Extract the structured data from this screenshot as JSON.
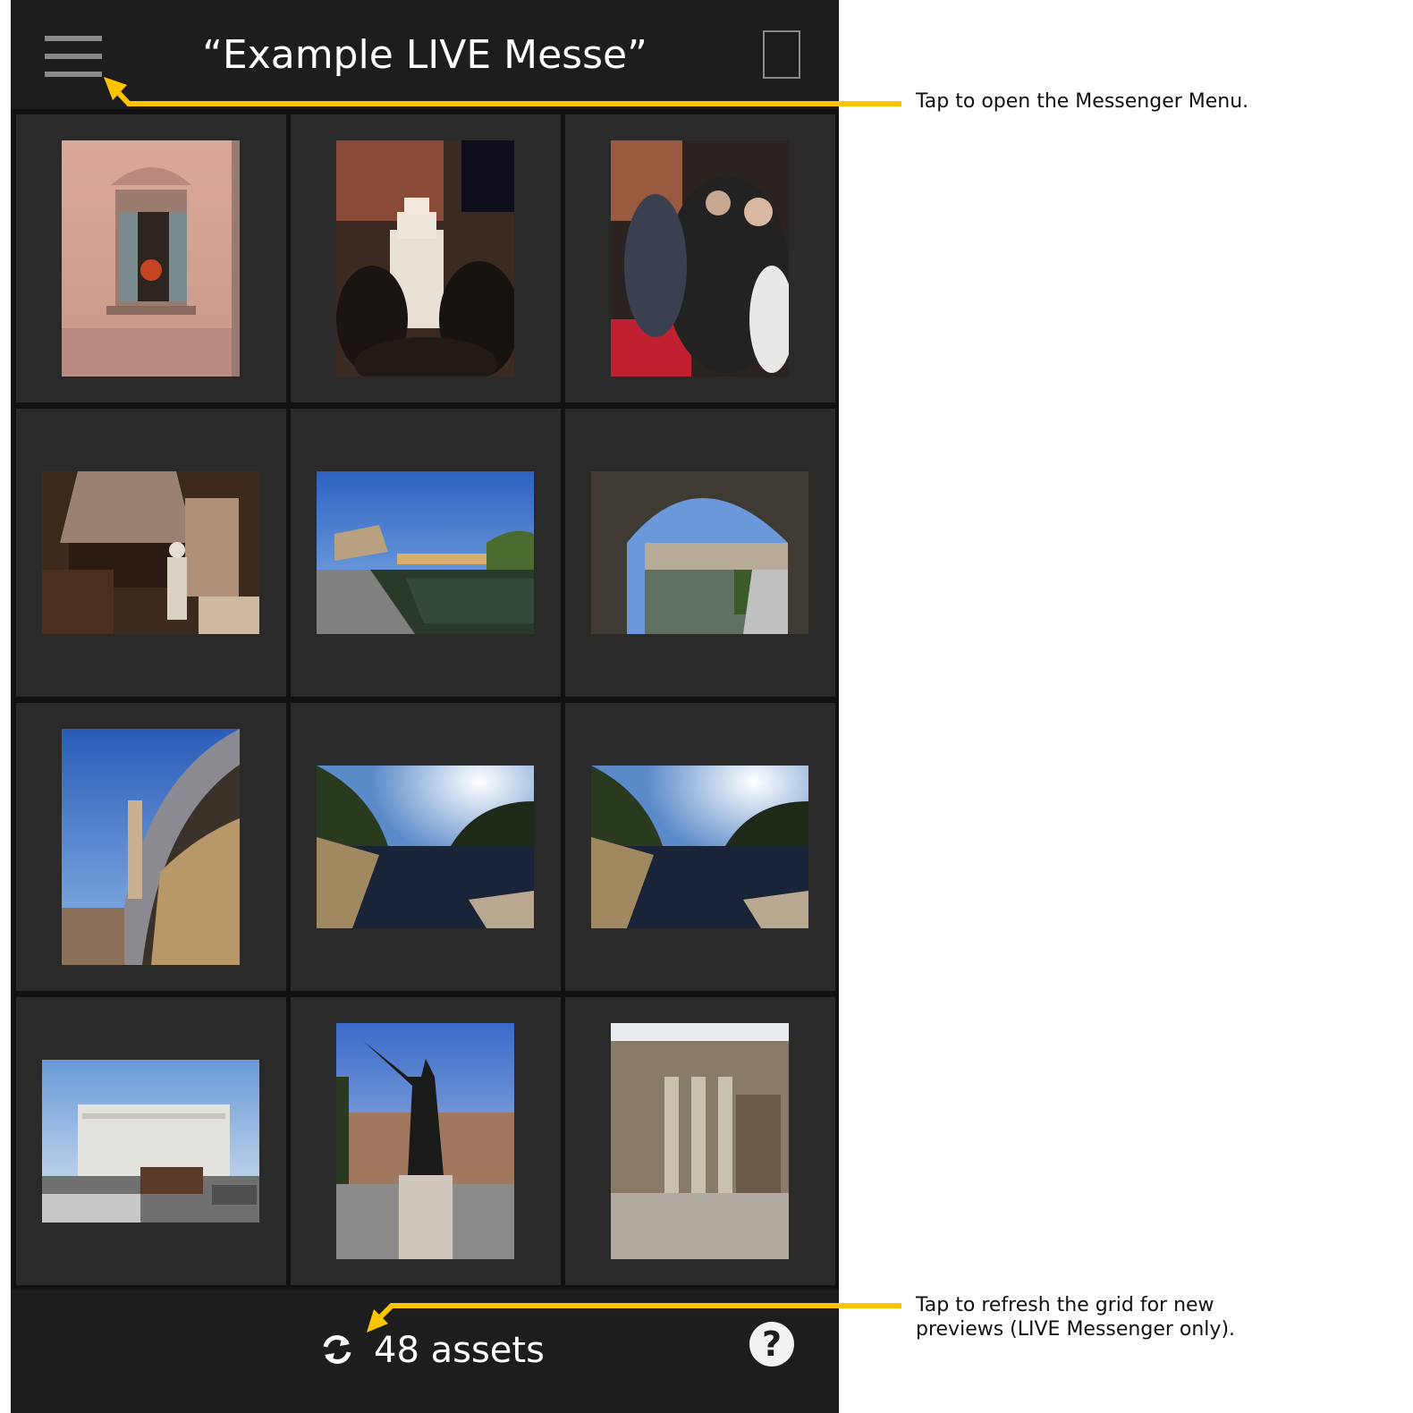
{
  "header": {
    "title": "“Example LIVE Messe”"
  },
  "grid": {
    "tiles": [
      {
        "thumbnail": "window-facade-photo"
      },
      {
        "thumbnail": "street-cake-crowd-photo"
      },
      {
        "thumbnail": "photographers-red-carpet-photo"
      },
      {
        "thumbnail": "bakery-oven-photo"
      },
      {
        "thumbnail": "castle-bridge-river-photo"
      },
      {
        "thumbnail": "river-through-arch-photo"
      },
      {
        "thumbnail": "bridge-arch-statue-photo"
      },
      {
        "thumbnail": "river-sun-reflection-photo"
      },
      {
        "thumbnail": "river-sun-reflection-photo"
      },
      {
        "thumbnail": "monument-building-photo"
      },
      {
        "thumbnail": "emperor-statue-photo"
      },
      {
        "thumbnail": "ancient-ruins-photo"
      }
    ]
  },
  "footer": {
    "asset_count": "48 assets"
  },
  "annotations": {
    "menu_hint": "Tap to open the Messenger Menu.",
    "refresh_hint_line1": "Tap to refresh the grid for new",
    "refresh_hint_line2": "previews (LIVE Messenger only)."
  },
  "colors": {
    "accent_arrow": "#ffc400",
    "app_background": "#111111",
    "tile_background": "#2a2a2a",
    "bar_background": "#1d1d1d"
  },
  "icons": {
    "menu": "hamburger-icon",
    "select": "square-outline-icon",
    "refresh": "refresh-icon",
    "help": "help-icon"
  }
}
